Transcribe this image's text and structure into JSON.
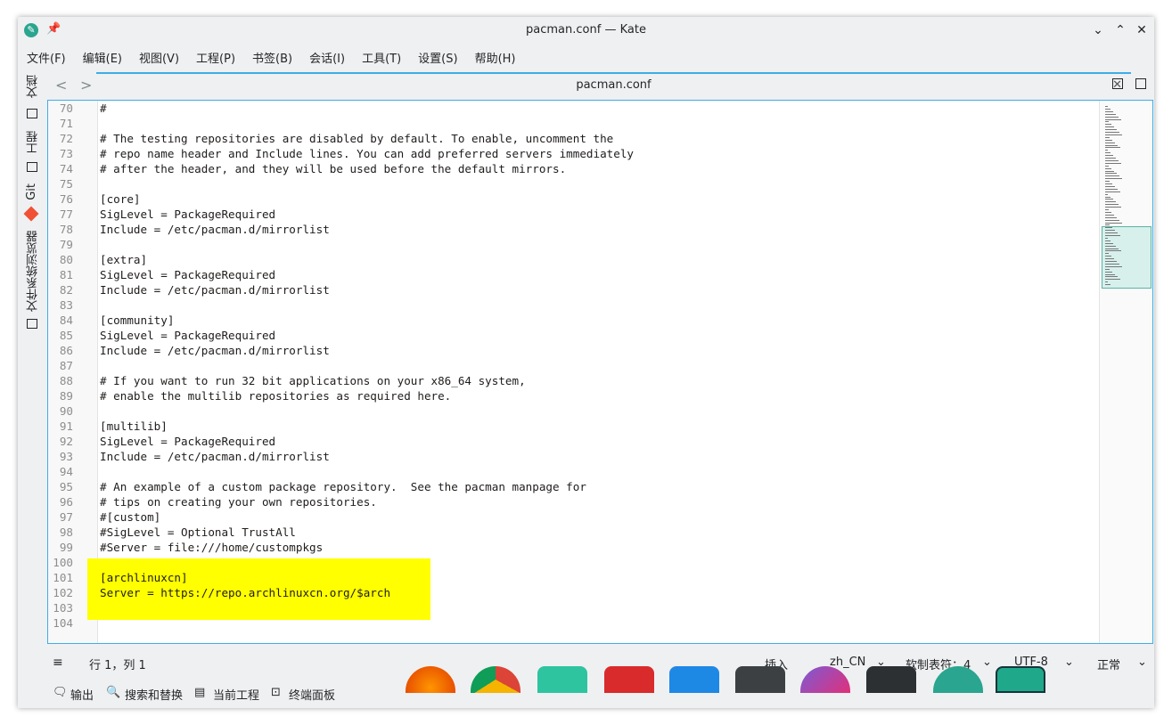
{
  "window": {
    "title": "pacman.conf — Kate",
    "controls": [
      "⌄",
      "⌃",
      "✕"
    ]
  },
  "menu": [
    "文件(F)",
    "编辑(E)",
    "视图(V)",
    "工程(P)",
    "书签(B)",
    "会话(I)",
    "工具(T)",
    "设置(S)",
    "帮助(H)"
  ],
  "sidebar": {
    "tabs": [
      "文档",
      "工程",
      "Git",
      "文件系统浏览器"
    ]
  },
  "tab": {
    "label": "pacman.conf",
    "close": "✕"
  },
  "nav": {
    "back": "<",
    "forward": ">"
  },
  "editor": {
    "lines": [
      {
        "n": "70",
        "t": "#"
      },
      {
        "n": "71",
        "t": ""
      },
      {
        "n": "72",
        "t": "# The testing repositories are disabled by default. To enable, uncomment the"
      },
      {
        "n": "73",
        "t": "# repo name header and Include lines. You can add preferred servers immediately"
      },
      {
        "n": "74",
        "t": "# after the header, and they will be used before the default mirrors."
      },
      {
        "n": "75",
        "t": ""
      },
      {
        "n": "76",
        "t": "[core]"
      },
      {
        "n": "77",
        "t": "SigLevel = PackageRequired"
      },
      {
        "n": "78",
        "t": "Include = /etc/pacman.d/mirrorlist"
      },
      {
        "n": "79",
        "t": ""
      },
      {
        "n": "80",
        "t": "[extra]"
      },
      {
        "n": "81",
        "t": "SigLevel = PackageRequired"
      },
      {
        "n": "82",
        "t": "Include = /etc/pacman.d/mirrorlist"
      },
      {
        "n": "83",
        "t": ""
      },
      {
        "n": "84",
        "t": "[community]"
      },
      {
        "n": "85",
        "t": "SigLevel = PackageRequired"
      },
      {
        "n": "86",
        "t": "Include = /etc/pacman.d/mirrorlist"
      },
      {
        "n": "87",
        "t": ""
      },
      {
        "n": "88",
        "t": "# If you want to run 32 bit applications on your x86_64 system,"
      },
      {
        "n": "89",
        "t": "# enable the multilib repositories as required here."
      },
      {
        "n": "90",
        "t": ""
      },
      {
        "n": "91",
        "t": "[multilib]"
      },
      {
        "n": "92",
        "t": "SigLevel = PackageRequired"
      },
      {
        "n": "93",
        "t": "Include = /etc/pacman.d/mirrorlist"
      },
      {
        "n": "94",
        "t": ""
      },
      {
        "n": "95",
        "t": "# An example of a custom package repository.  See the pacman manpage for"
      },
      {
        "n": "96",
        "t": "# tips on creating your own repositories."
      },
      {
        "n": "97",
        "t": "#[custom]"
      },
      {
        "n": "98",
        "t": "#SigLevel = Optional TrustAll"
      },
      {
        "n": "99",
        "t": "#Server = file:///home/custompkgs"
      },
      {
        "n": "100",
        "t": ""
      },
      {
        "n": "101",
        "t": "[archlinuxcn]"
      },
      {
        "n": "102",
        "t": "Server = https://repo.archlinuxcn.org/$arch"
      },
      {
        "n": "103",
        "t": ""
      },
      {
        "n": "104",
        "t": ""
      }
    ]
  },
  "status": {
    "cursor": "行 1，列 1",
    "mode": "插入",
    "lang": "zh_CN",
    "tabs": "软制表符：4",
    "encoding": "UTF-8",
    "view": "正常"
  },
  "bottom": {
    "output": "输出",
    "search": "搜索和替换",
    "project": "当前工程",
    "terminal": "终端面板"
  },
  "colors": {
    "accent": "#3daee9",
    "highlight": "#ffff00"
  }
}
